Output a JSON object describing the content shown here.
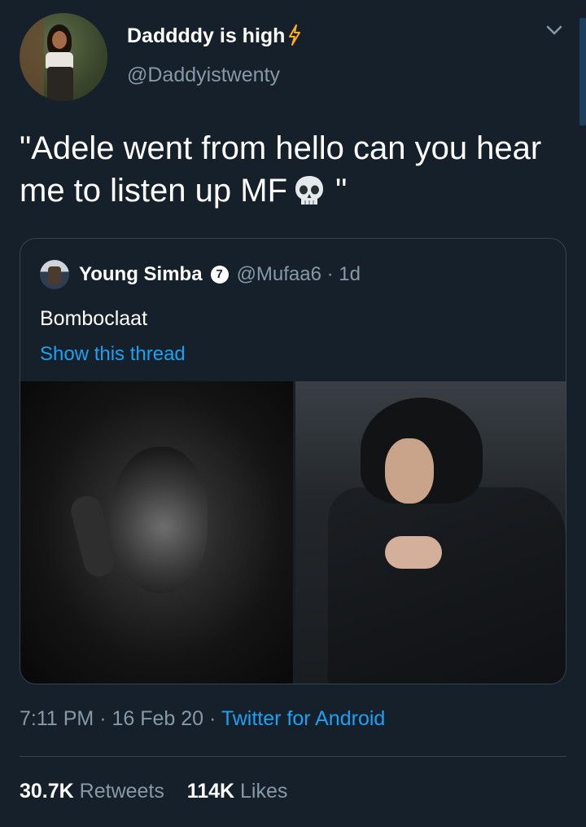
{
  "author": {
    "display_name": "Daddddy is high",
    "handle": "@Daddyistwenty"
  },
  "tweet": {
    "text": "\"Adele went from hello can you hear me to listen up MF",
    "text_end": " \""
  },
  "quoted": {
    "name": "Young Simba",
    "verified_badge": "7",
    "handle_time": "@Mufaa6 · 1d",
    "body": "Bomboclaat",
    "thread_link": "Show this thread"
  },
  "meta": {
    "time_date": "7:11 PM · 16 Feb 20 · ",
    "source": "Twitter for Android"
  },
  "stats": {
    "retweets_count": "30.7K",
    "retweets_label": " Retweets",
    "likes_count": "114K",
    "likes_label": " Likes"
  },
  "colors": {
    "background": "#15202b",
    "accent": "#1da1f2",
    "muted": "#8899a6",
    "border": "#38444d",
    "bolt": "#ffad1f"
  },
  "icons": {
    "bolt": "lightning-icon",
    "skull": "skull-emoji",
    "chevron": "chevron-down-icon"
  }
}
